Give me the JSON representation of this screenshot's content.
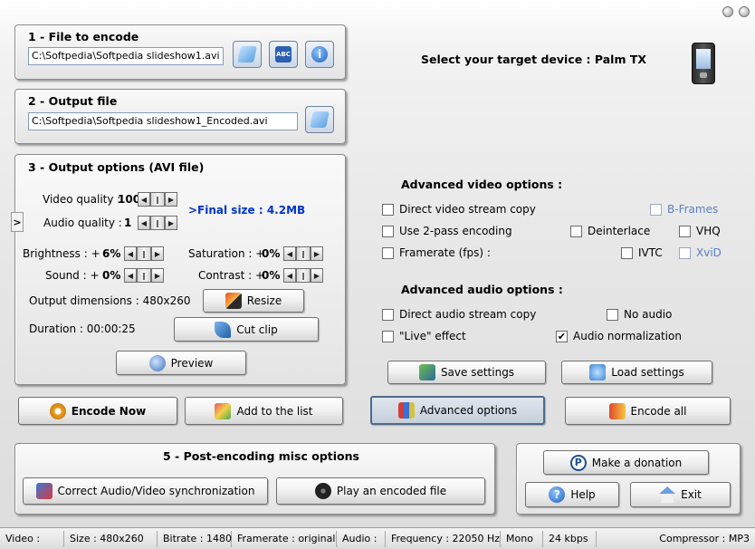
{
  "colors": {
    "accent_blue": "#0033cc",
    "disabled_blue": "#5b7fc2"
  },
  "device": {
    "label": "Select your target device : Palm TX",
    "icon": "pda-icon"
  },
  "panel1": {
    "title": "1 - File to encode",
    "file_value": "C:\\Softpedia\\Softpedia slideshow1.avi",
    "icons": [
      "open-folder-icon",
      "abc-icon",
      "info-icon"
    ]
  },
  "panel2": {
    "title": "2 - Output file",
    "file_value": "C:\\Softpedia\\Softpedia slideshow1_Encoded.avi",
    "icons": [
      "open-folder-icon"
    ]
  },
  "panel3": {
    "title": "3 - Output options (AVI file)",
    "video_quality_label": "Video quality :",
    "video_quality_value": "100",
    "audio_quality_label": "Audio quality :",
    "audio_quality_value": "1",
    "final_size": ">Final size : 4.2MB",
    "brightness_label": "Brightness : +",
    "brightness_value": "6%",
    "saturation_label": "Saturation : +",
    "saturation_value": "0%",
    "sound_label": "Sound : +",
    "sound_value": "0%",
    "contrast_label": "Contrast : +",
    "contrast_value": "0%",
    "dimensions": "Output dimensions : 480x260",
    "duration": "Duration : 00:00:25",
    "resize_label": "Resize",
    "cut_label": "Cut clip",
    "preview_label": "Preview",
    "side_arrow": ">"
  },
  "advanced_video": {
    "title": "Advanced video options :",
    "direct_copy": "Direct video stream copy",
    "bframes": "B-Frames",
    "two_pass": "Use 2-pass encoding",
    "deinterlace": "Deinterlace",
    "vhq": "VHQ",
    "framerate": "Framerate (fps) :",
    "ivtc": "IVTC",
    "xvid": "XviD"
  },
  "advanced_audio": {
    "title": "Advanced audio options :",
    "direct_copy": "Direct audio stream copy",
    "no_audio": "No audio",
    "live_effect": "\"Live\" effect",
    "normalization": "Audio normalization"
  },
  "buttons": {
    "save_settings": "Save settings",
    "load_settings": "Load settings",
    "encode_now": "Encode Now",
    "add_to_list": "Add to the list",
    "advanced_options": "Advanced options",
    "encode_all": "Encode all"
  },
  "panel5": {
    "title": "5 - Post-encoding misc options",
    "correct_sync": "Correct Audio/Video synchronization",
    "play_encoded": "Play an encoded file"
  },
  "misc": {
    "donation": "Make a donation",
    "help": "Help",
    "exit": "Exit"
  },
  "status": {
    "video": "Video :",
    "size": "Size : 480x260",
    "bitrate": "Bitrate : 1480",
    "framerate": "Framerate : original",
    "audio": "Audio :",
    "frequency": "Frequency : 22050 Hz",
    "channels": "Mono",
    "kbps": "24 kbps",
    "compressor": "Compressor : MP3"
  }
}
